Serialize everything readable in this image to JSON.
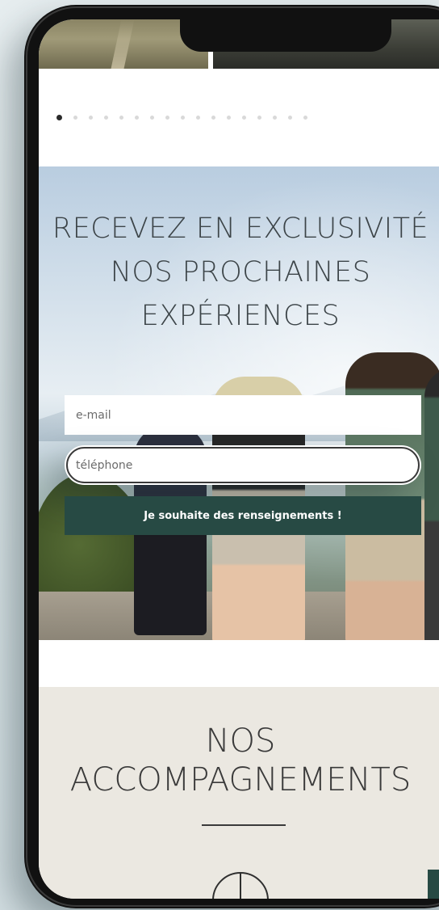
{
  "carousel": {
    "dots_total": 17,
    "active_index": 0
  },
  "newsletter": {
    "title": "RECEVEZ EN EXCLUSIVITÉ\nNOS PROCHAINES\nEXPÉRIENCES",
    "email_placeholder": "e-mail",
    "phone_placeholder": "téléphone",
    "submit_label": "Je souhaite des renseignements !"
  },
  "accompagnements": {
    "title": "NOS\nACCOMPAGNEMENTS"
  },
  "colors": {
    "accent": "#274a44",
    "section_bg": "#ebe8e1",
    "text": "#3c4448"
  },
  "icons": {
    "compass": "compass-icon"
  }
}
